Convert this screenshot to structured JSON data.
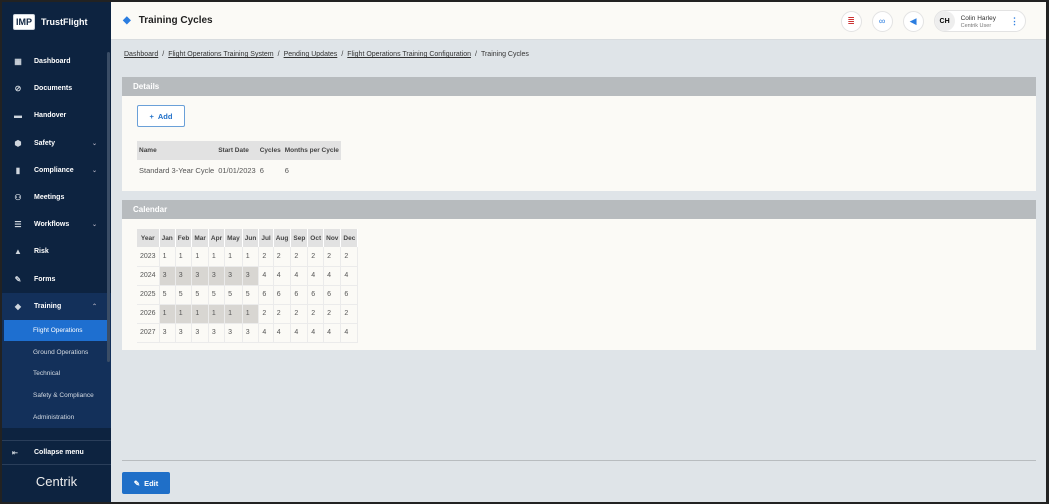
{
  "app": {
    "logo_mark": "IMP",
    "name": "TrustFlight",
    "footer_logo": "Centrik"
  },
  "sidebar": {
    "items": [
      {
        "label": "Dashboard",
        "icon": "dashboard-icon",
        "glyph": "▦"
      },
      {
        "label": "Documents",
        "icon": "paperclip-icon",
        "glyph": "⊘"
      },
      {
        "label": "Handover",
        "icon": "handover-icon",
        "glyph": "▬"
      },
      {
        "label": "Safety",
        "icon": "shield-icon",
        "glyph": "⬢",
        "chevron": "⌄"
      },
      {
        "label": "Compliance",
        "icon": "compliance-icon",
        "glyph": "▮",
        "chevron": "⌄"
      },
      {
        "label": "Meetings",
        "icon": "meetings-icon",
        "glyph": "⚇"
      },
      {
        "label": "Workflows",
        "icon": "workflows-icon",
        "glyph": "☰",
        "chevron": "⌄"
      },
      {
        "label": "Risk",
        "icon": "risk-icon",
        "glyph": "▲"
      },
      {
        "label": "Forms",
        "icon": "forms-icon",
        "glyph": "✎"
      },
      {
        "label": "Training",
        "icon": "graduation-cap-icon",
        "glyph": "◆",
        "chevron": "⌃"
      }
    ],
    "training_sub": [
      "Flight Operations",
      "Ground Operations",
      "Technical",
      "Safety & Compliance",
      "Administration"
    ],
    "collapse_label": "Collapse menu"
  },
  "header": {
    "title": "Training Cycles",
    "user": {
      "initials": "CH",
      "name": "Colin Harley",
      "role": "Centrik User"
    }
  },
  "breadcrumb": [
    "Dashboard",
    "Flight Operations Training System",
    "Pending Updates",
    "Flight Operations Training Configuration"
  ],
  "breadcrumb_current": "Training Cycles",
  "details": {
    "title": "Details",
    "add_label": "Add",
    "columns": [
      "Name",
      "Start Date",
      "Cycles",
      "Months per Cycle"
    ],
    "rows": [
      [
        "Standard 3-Year Cycle",
        "01/01/2023",
        "6",
        "6"
      ]
    ]
  },
  "calendar": {
    "title": "Calendar",
    "columns": [
      "Year",
      "Jan",
      "Feb",
      "Mar",
      "Apr",
      "May",
      "Jun",
      "Jul",
      "Aug",
      "Sep",
      "Oct",
      "Nov",
      "Dec"
    ],
    "rows": [
      {
        "year": "2023",
        "values": [
          "1",
          "1",
          "1",
          "1",
          "1",
          "1",
          "2",
          "2",
          "2",
          "2",
          "2",
          "2"
        ],
        "highlighted": false
      },
      {
        "year": "2024",
        "values": [
          "3",
          "3",
          "3",
          "3",
          "3",
          "3",
          "4",
          "4",
          "4",
          "4",
          "4",
          "4"
        ],
        "highlighted": true
      },
      {
        "year": "2025",
        "values": [
          "5",
          "5",
          "5",
          "5",
          "5",
          "5",
          "6",
          "6",
          "6",
          "6",
          "6",
          "6"
        ],
        "highlighted": false
      },
      {
        "year": "2026",
        "values": [
          "1",
          "1",
          "1",
          "1",
          "1",
          "1",
          "2",
          "2",
          "2",
          "2",
          "2",
          "2"
        ],
        "highlighted": true
      },
      {
        "year": "2027",
        "values": [
          "3",
          "3",
          "3",
          "3",
          "3",
          "3",
          "4",
          "4",
          "4",
          "4",
          "4",
          "4"
        ],
        "highlighted": false
      }
    ]
  },
  "edit_label": "Edit"
}
